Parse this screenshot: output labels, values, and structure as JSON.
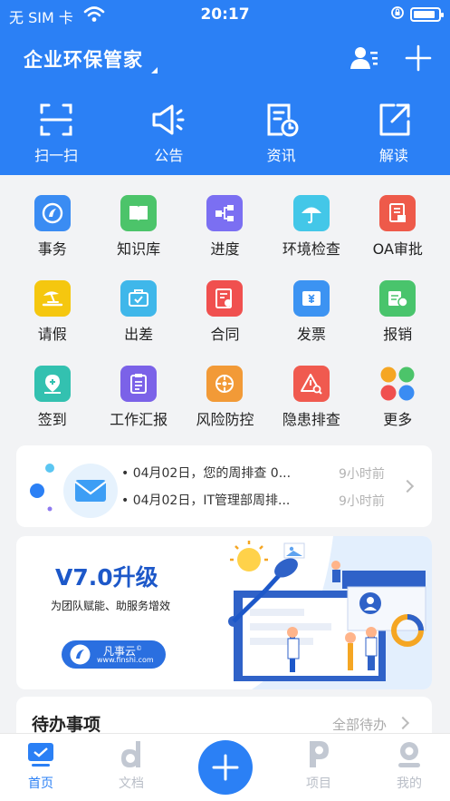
{
  "status_bar": {
    "carrier": "无 SIM 卡",
    "time": "20:17",
    "battery_level": 0.9
  },
  "header": {
    "title": "企业环保管家",
    "contacts_icon": "contacts-icon",
    "add_icon": "plus-icon",
    "quick_actions": [
      {
        "label": "扫一扫",
        "icon": "scan-icon"
      },
      {
        "label": "公告",
        "icon": "megaphone-icon"
      },
      {
        "label": "资讯",
        "icon": "news-icon"
      },
      {
        "label": "解读",
        "icon": "share-icon"
      }
    ]
  },
  "grid": [
    [
      {
        "label": "事务",
        "icon": "affairs-icon",
        "color": "#3a8cf3"
      },
      {
        "label": "知识库",
        "icon": "book-icon",
        "color": "#4cc46a"
      },
      {
        "label": "进度",
        "icon": "flow-icon",
        "color": "#7b6ff2"
      },
      {
        "label": "环境检查",
        "icon": "umbrella-icon",
        "color": "#43c7e8"
      },
      {
        "label": "OA审批",
        "icon": "approval-icon",
        "color": "#ee5a4a"
      }
    ],
    [
      {
        "label": "请假",
        "icon": "leave-icon",
        "color": "#f5c70f"
      },
      {
        "label": "出差",
        "icon": "trip-icon",
        "color": "#3fb7ea"
      },
      {
        "label": "合同",
        "icon": "contract-icon",
        "color": "#f0504f"
      },
      {
        "label": "发票",
        "icon": "invoice-icon",
        "color": "#3c93f2"
      },
      {
        "label": "报销",
        "icon": "reimburse-icon",
        "color": "#49c46c"
      }
    ],
    [
      {
        "label": "签到",
        "icon": "checkin-icon",
        "color": "#33c1b0"
      },
      {
        "label": "工作汇报",
        "icon": "report-icon",
        "color": "#7b62e8"
      },
      {
        "label": "风险防控",
        "icon": "risk-icon",
        "color": "#f29a37"
      },
      {
        "label": "隐患排查",
        "icon": "hazard-icon",
        "color": "#f05a4f"
      },
      {
        "label": "更多",
        "icon": "more-icon",
        "color": "#ffffff"
      }
    ]
  ],
  "messages": {
    "icon": "mail-icon",
    "items": [
      {
        "text": "• 04月02日，您的周排查 0...",
        "time": "9小时前"
      },
      {
        "text": "• 04月02日，IT管理部周排...",
        "time": "9小时前"
      }
    ]
  },
  "banner": {
    "title": "V7.0升级",
    "subtitle": "为团队赋能、助服务增效",
    "brand": "凡事云",
    "brand_mark": "©",
    "url": "www.finshi.com"
  },
  "todo": {
    "title": "待办事项",
    "all_label": "全部待办"
  },
  "tabbar": {
    "items": [
      {
        "label": "首页",
        "icon": "home-icon",
        "active": true
      },
      {
        "label": "文档",
        "icon": "document-icon",
        "active": false
      },
      {
        "label": "项目",
        "icon": "project-icon",
        "active": false
      },
      {
        "label": "我的",
        "icon": "profile-icon",
        "active": false
      }
    ],
    "fab_icon": "plus-icon"
  },
  "colors": {
    "primary": "#2b80f5",
    "background": "#f2f3f5"
  }
}
